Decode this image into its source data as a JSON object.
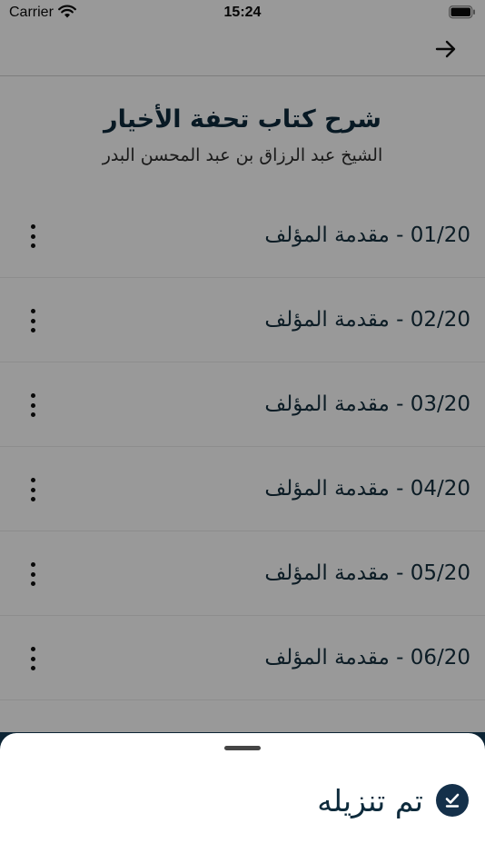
{
  "status_bar": {
    "carrier": "Carrier",
    "time": "15:24",
    "icons": [
      "wifi-icon",
      "battery-icon"
    ]
  },
  "nav": {
    "back_icon": "arrow-right-icon"
  },
  "header": {
    "title": "شرح كتاب تحفة الأخيار",
    "subtitle": "الشيخ عبد الرزاق بن عبد المحسن البدر"
  },
  "lessons": [
    {
      "label": "01/20 - مقدمة المؤلف"
    },
    {
      "label": "02/20 - مقدمة المؤلف"
    },
    {
      "label": "03/20 - مقدمة المؤلف"
    },
    {
      "label": "04/20 - مقدمة المؤلف"
    },
    {
      "label": "05/20 - مقدمة المؤلف"
    },
    {
      "label": "06/20 - مقدمة المؤلف"
    }
  ],
  "bottom_sheet": {
    "action_label": "تم تنزيله",
    "action_icon": "download-done-icon"
  },
  "colors": {
    "accent": "#0e2b3c",
    "overlay": "rgba(0,0,0,0.4)",
    "sheet_strip": "#0c2434"
  }
}
